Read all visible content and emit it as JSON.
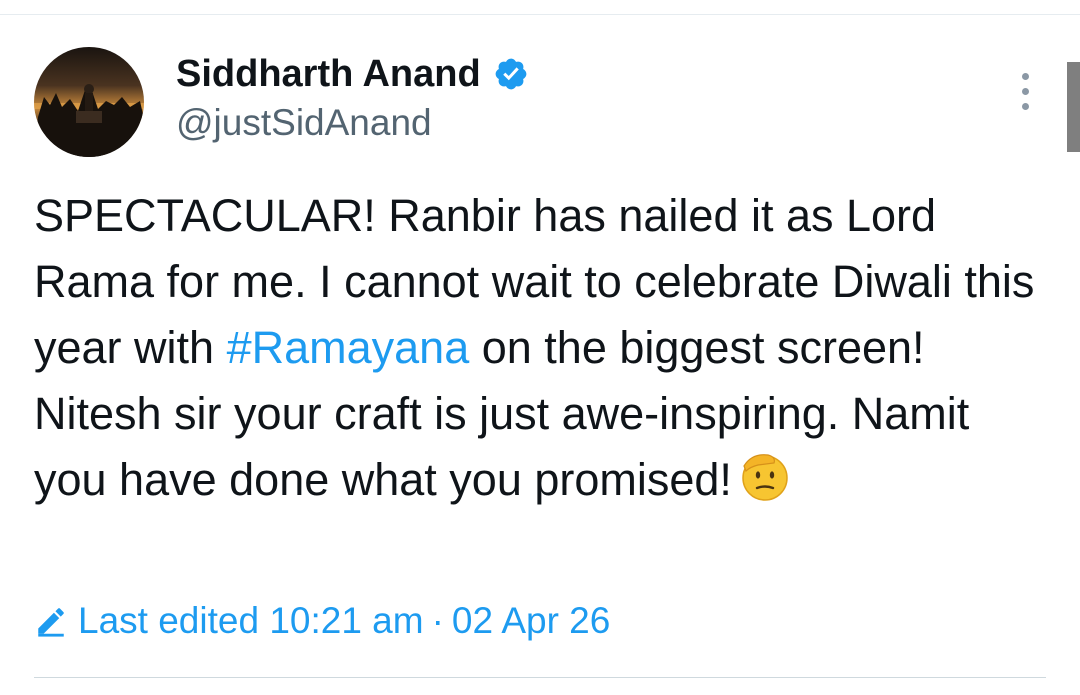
{
  "tweet": {
    "author": {
      "name": "Siddharth Anand",
      "handle": "@justSidAnand",
      "verified": true,
      "avatar_icon": "profile-photo-sunset-crowd"
    },
    "more_icon": "vertical-ellipsis-icon",
    "text": {
      "before_hashtag": "SPECTACULAR! Ranbir has nailed it as Lord Rama for me. I cannot wait to celebrate Diwali this year with ",
      "hashtag": "#Ramayana",
      "after_hashtag": " on the biggest screen! Nitesh sir your craft is just awe-inspiring. Namit you have done what you promised!",
      "emoji": "salute-face-emoji"
    },
    "edit_info": {
      "label": "Last edited",
      "time": "10:21 am",
      "separator": "·",
      "date": "02 Apr 26"
    }
  },
  "colors": {
    "link": "#1d9bf0",
    "secondary_text": "#536471",
    "primary_text": "#0f1419",
    "verified_badge": "#1d9bf0"
  }
}
